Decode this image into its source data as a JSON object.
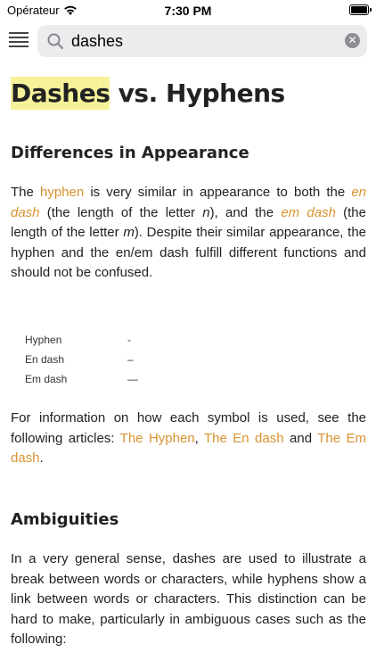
{
  "status_bar": {
    "carrier": "Opérateur",
    "time": "7:30 PM"
  },
  "search": {
    "value": "dashes",
    "icon": "search-icon"
  },
  "article": {
    "title_highlight": "Dashes",
    "title_rest": " vs. Hyphens",
    "sections": [
      {
        "heading": "Differences in Appearance",
        "para1": {
          "t1": "The ",
          "l1": "hyphen",
          "t2": " is very similar in appearance to both the ",
          "l2": "en dash",
          "t3": " (the length of the letter ",
          "v1": "n",
          "t4": "), and the ",
          "l3": "em dash",
          "t5": " (the length of the letter ",
          "v2": "m",
          "t6": "). Despite their similar appearance, the hyphen and the en/em dash fulfill different functions and should not be confused."
        },
        "dash_table": [
          {
            "name": "Hyphen",
            "symbol": "-"
          },
          {
            "name": "En dash",
            "symbol": "–"
          },
          {
            "name": "Em dash",
            "symbol": "—"
          }
        ],
        "para2": {
          "t1": "For information on how each symbol is used, see the following articles: ",
          "l1": "The Hyphen",
          "t2": ", ",
          "l2": "The En dash",
          "t3": " and ",
          "l3": "The Em dash",
          "t4": "."
        }
      },
      {
        "heading": "Ambiguities",
        "para": "In a very general sense, dashes are used to illustrate a break between words or characters, while hyphens show a link between words or characters. This distinction can be hard to make, particularly in ambiguous cases such as the following:"
      }
    ]
  }
}
